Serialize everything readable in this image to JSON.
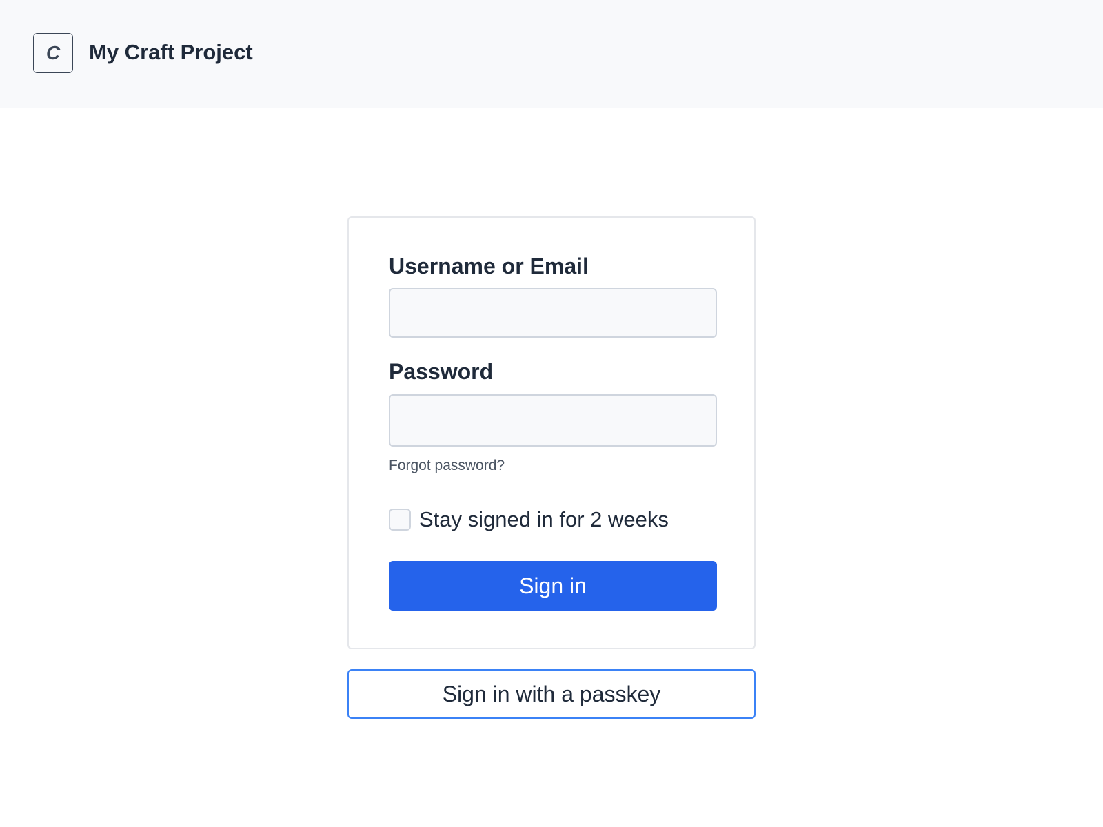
{
  "header": {
    "logo_letter": "C",
    "site_name": "My Craft Project"
  },
  "login": {
    "username_label": "Username or Email",
    "username_value": "",
    "password_label": "Password",
    "password_value": "",
    "forgot_password": "Forgot password?",
    "remember_me_label": "Stay signed in for 2 weeks",
    "remember_me_checked": false,
    "submit_label": "Sign in"
  },
  "passkey": {
    "button_label": "Sign in with a passkey"
  },
  "colors": {
    "accent": "#2563eb",
    "passkey_border": "#3b82f6",
    "header_bg": "#f8f9fb",
    "text": "#1f2a3a"
  }
}
